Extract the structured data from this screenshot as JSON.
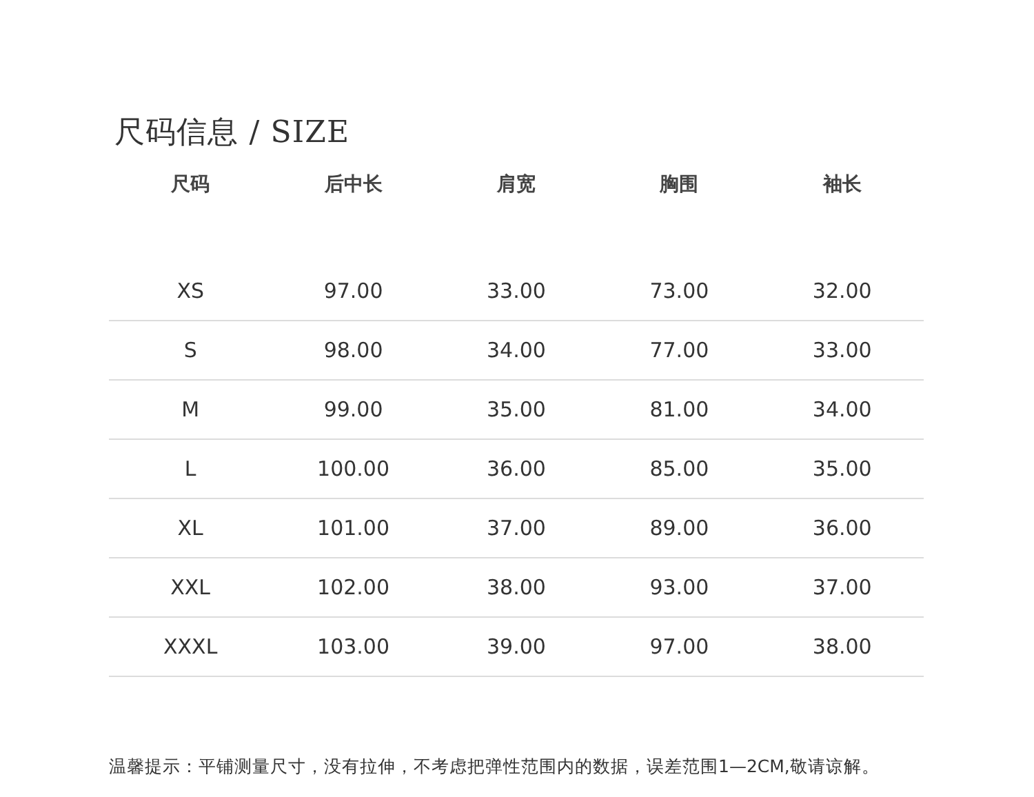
{
  "title": "尺码信息 / SIZE",
  "table": {
    "columns": [
      "尺码",
      "后中长",
      "肩宽",
      "胸围",
      "袖长"
    ],
    "rows": [
      [
        "XS",
        "97.00",
        "33.00",
        "73.00",
        "32.00"
      ],
      [
        "S",
        "98.00",
        "34.00",
        "77.00",
        "33.00"
      ],
      [
        "M",
        "99.00",
        "35.00",
        "81.00",
        "34.00"
      ],
      [
        "L",
        "100.00",
        "36.00",
        "85.00",
        "35.00"
      ],
      [
        "XL",
        "101.00",
        "37.00",
        "89.00",
        "36.00"
      ],
      [
        "XXL",
        "102.00",
        "38.00",
        "93.00",
        "37.00"
      ],
      [
        "XXXL",
        "103.00",
        "39.00",
        "97.00",
        "38.00"
      ]
    ]
  },
  "note": "温馨提示：平铺测量尺寸，没有拉伸，不考虑把弹性范围内的数据，误差范围1—2CM,敬请谅解。"
}
